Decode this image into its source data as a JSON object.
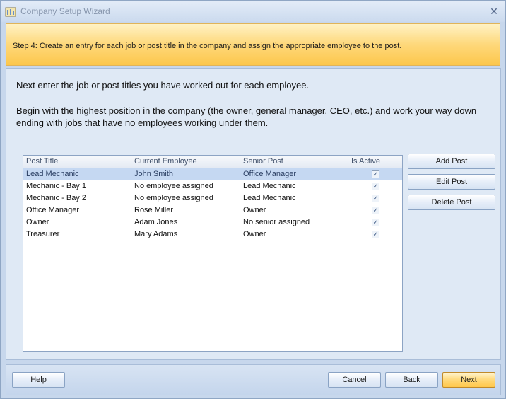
{
  "window": {
    "title": "Company Setup Wizard"
  },
  "banner": {
    "step_text": "Step 4: Create an entry for each job or post title in the company and assign the appropriate employee to the post."
  },
  "intro": {
    "line1": "Next enter the job or post titles you have worked out for each employee.",
    "line2": "Begin with the highest position in the company (the owner, general manager, CEO, etc.) and work your way down ending with jobs that have no employees working under them."
  },
  "grid": {
    "columns": [
      "Post Title",
      "Current Employee",
      "Senior Post",
      "Is Active"
    ],
    "rows": [
      {
        "title": "Lead Mechanic",
        "employee": "John Smith",
        "senior": "Office Manager",
        "active": true,
        "selected": true
      },
      {
        "title": "Mechanic - Bay 1",
        "employee": "No employee assigned",
        "senior": "Lead Mechanic",
        "active": true,
        "selected": false
      },
      {
        "title": "Mechanic - Bay 2",
        "employee": "No employee assigned",
        "senior": "Lead Mechanic",
        "active": true,
        "selected": false
      },
      {
        "title": "Office Manager",
        "employee": "Rose Miller",
        "senior": "Owner",
        "active": true,
        "selected": false
      },
      {
        "title": "Owner",
        "employee": "Adam Jones",
        "senior": "No senior assigned",
        "active": true,
        "selected": false
      },
      {
        "title": "Treasurer",
        "employee": "Mary Adams",
        "senior": "Owner",
        "active": true,
        "selected": false
      }
    ]
  },
  "side_buttons": {
    "add": "Add Post",
    "edit": "Edit Post",
    "delete": "Delete Post"
  },
  "footer": {
    "help": "Help",
    "cancel": "Cancel",
    "back": "Back",
    "next": "Next"
  },
  "icons": {
    "app": "wizard-app-icon",
    "close": "close-icon",
    "check": "checkbox-checked-icon"
  },
  "colors": {
    "banner": "#fed87a",
    "selection": "#c5d8f2",
    "frame": "#c7d7ec"
  }
}
